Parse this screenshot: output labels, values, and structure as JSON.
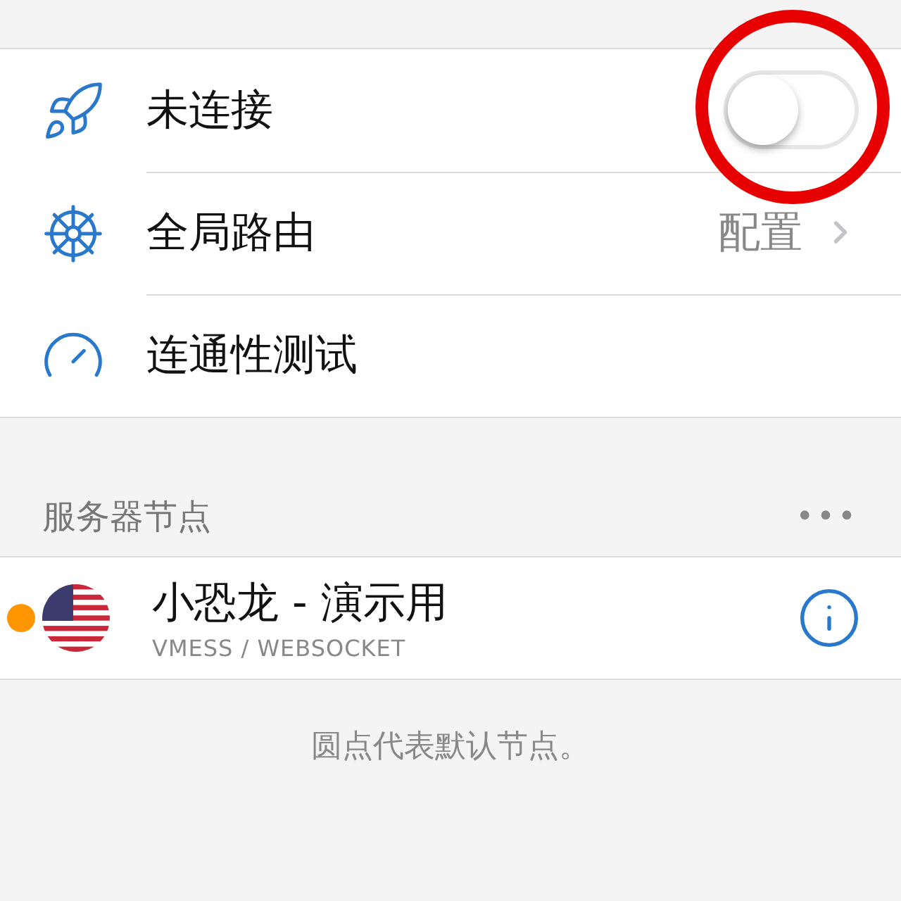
{
  "settings": [
    {
      "kind": "toggle",
      "label": "未连接",
      "on": false,
      "highlighted": true
    },
    {
      "kind": "link",
      "label": "全局路由",
      "value": "配置"
    },
    {
      "kind": "plain",
      "label": "连通性测试"
    }
  ],
  "servers_section": {
    "title": "服务器节点",
    "more": "•••",
    "servers": [
      {
        "name": "小恐龙 - 演示用",
        "protocol": "VMESS / WEBSOCKET",
        "color": "#ff9500"
      }
    ],
    "footer": "圆点代表默认节点。"
  }
}
